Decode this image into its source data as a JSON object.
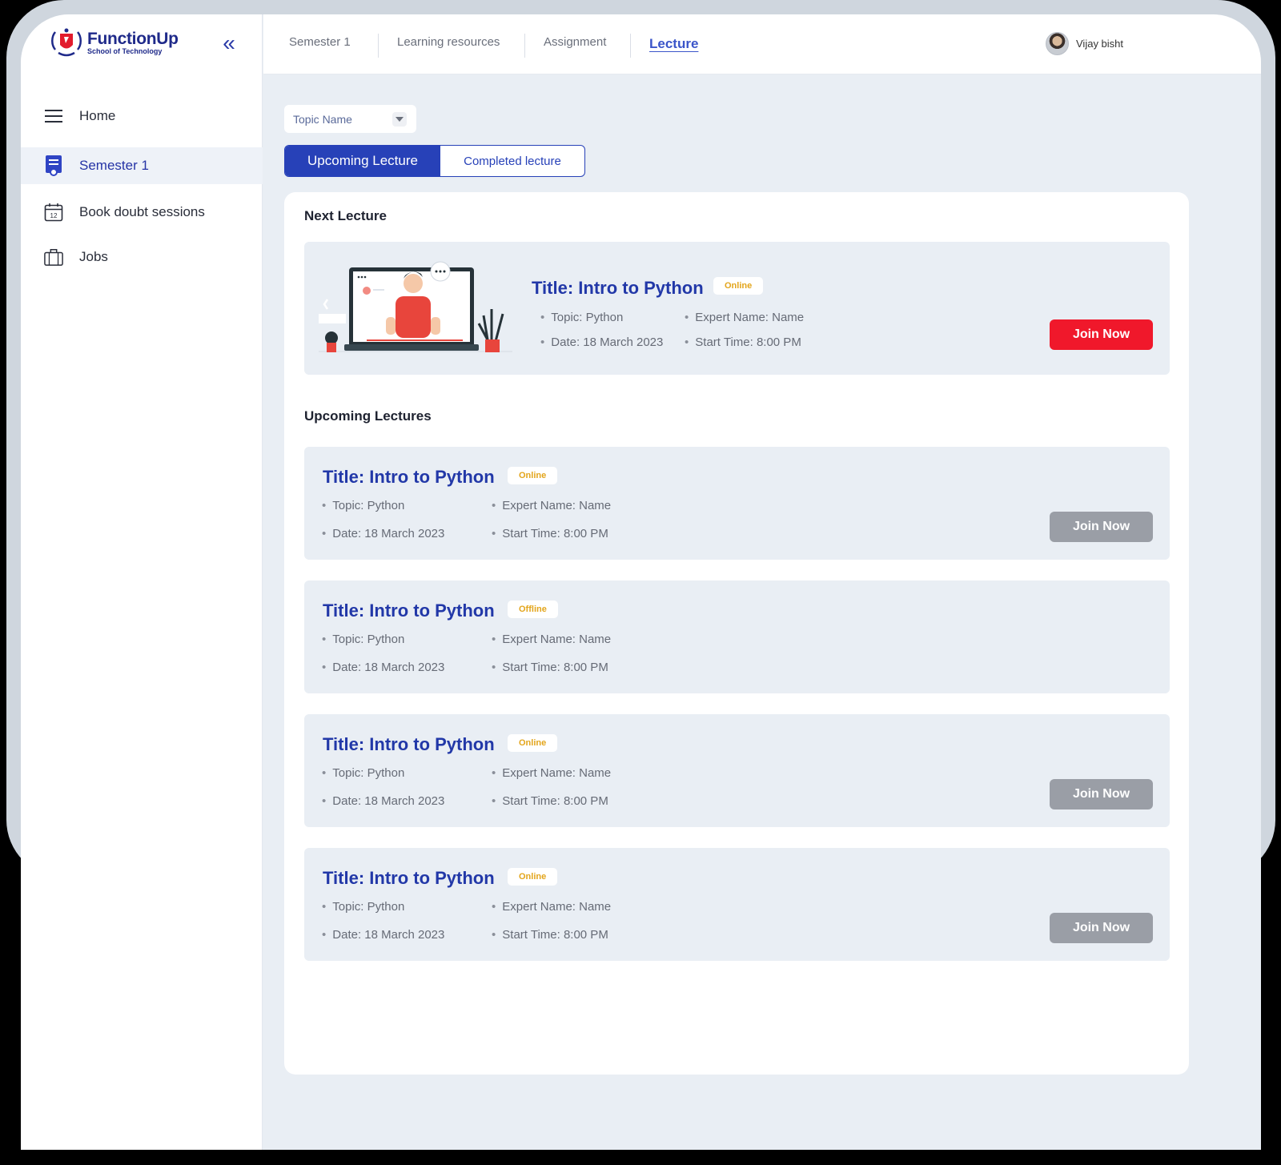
{
  "brand": {
    "name": "FunctionUp",
    "subtitle": "School of Technology"
  },
  "sidebar": {
    "collapse_icon": "double-chevron-left-icon",
    "items": [
      {
        "label": "Home",
        "icon": "menu-icon",
        "active": false
      },
      {
        "label": "Semester 1",
        "icon": "document-badge-icon",
        "active": true
      },
      {
        "label": "Book doubt sessions",
        "icon": "calendar-icon",
        "active": false
      },
      {
        "label": "Jobs",
        "icon": "briefcase-icon",
        "active": false
      }
    ]
  },
  "header": {
    "tabs": [
      {
        "label": "Semester 1",
        "active": false
      },
      {
        "label": "Learning resources",
        "active": false
      },
      {
        "label": "Assignment",
        "active": false
      },
      {
        "label": "Lecture",
        "active": true
      }
    ],
    "user": {
      "name": "Vijay bisht"
    }
  },
  "filter": {
    "placeholder": "Topic Name"
  },
  "toggle": {
    "upcoming": "Upcoming Lecture",
    "completed": "Completed lecture",
    "selected": "upcoming"
  },
  "next_lecture": {
    "heading": "Next Lecture",
    "title": "Title: Intro to Python",
    "mode": "Online",
    "topic": "Topic: Python",
    "expert": "Expert Name: Name",
    "date": "Date: 18 March 2023",
    "start": "Start Time: 8:00 PM",
    "button": "Join Now"
  },
  "upcoming": {
    "heading": "Upcoming Lectures",
    "items": [
      {
        "title": "Title: Intro to Python",
        "mode": "Online",
        "topic": "Topic: Python",
        "expert": "Expert Name: Name",
        "date": "Date: 18 March 2023",
        "start": "Start Time: 8:00 PM",
        "button": "Join Now"
      },
      {
        "title": "Title: Intro to Python",
        "mode": "Offline",
        "topic": "Topic: Python",
        "expert": "Expert Name: Name",
        "date": "Date: 18 March 2023",
        "start": "Start Time: 8:00 PM"
      },
      {
        "title": "Title: Intro to Python",
        "mode": "Online",
        "topic": "Topic: Python",
        "expert": "Expert Name: Name",
        "date": "Date: 18 March 2023",
        "start": "Start Time: 8:00 PM",
        "button": "Join Now"
      },
      {
        "title": "Title: Intro to Python",
        "mode": "Online",
        "topic": "Topic: Python",
        "expert": "Expert Name: Name",
        "date": "Date: 18 March 2023",
        "start": "Start Time: 8:00 PM",
        "button": "Join Now"
      }
    ]
  },
  "colors": {
    "primary": "#2741b8",
    "join_active": "#f0182b",
    "join_disabled": "#9a9ea6",
    "badge_text": "#e3a51c",
    "page_bg": "#e9eef4"
  }
}
